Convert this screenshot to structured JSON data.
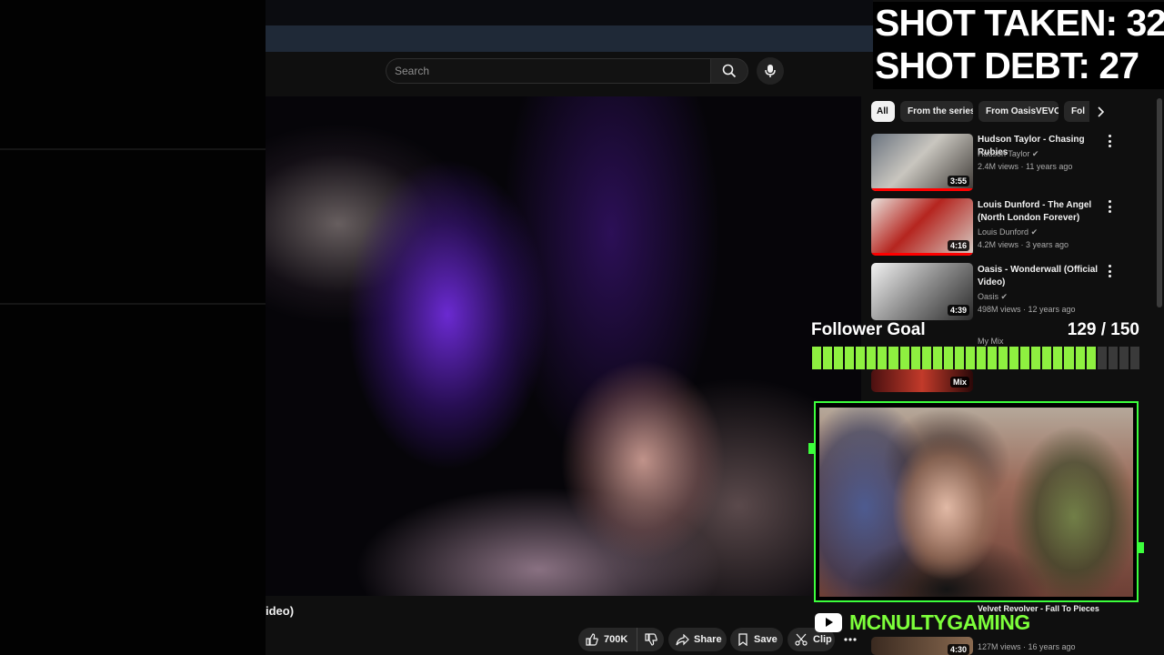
{
  "overlay": {
    "shot_taken": "SHOT TAKEN: 32",
    "shot_debt": "SHOT DEBT: 27",
    "follower_goal_label": "Follower Goal",
    "follower_goal_count": "129 / 150",
    "follower_goal_progress": 0.86,
    "channel_name": "MCNULTYGAMING",
    "accent_color": "#8ef040"
  },
  "header": {
    "search_placeholder": "Search"
  },
  "video": {
    "title_partial": "ideo)",
    "actions": {
      "like_count": "700K",
      "share_label": "Share",
      "save_label": "Save",
      "clip_label": "Clip"
    }
  },
  "sidebar": {
    "chips": [
      "All",
      "From the series",
      "From OasisVEVO",
      "Fol"
    ],
    "recommendations": [
      {
        "title": "Hudson Taylor - Chasing Rubies",
        "channel": "Hudson Taylor",
        "meta": "2.4M views · 11 years ago",
        "duration": "3:55"
      },
      {
        "title": "Louis Dunford - The Angel (North London Forever)",
        "channel": "Louis Dunford",
        "meta": "4.2M views · 3 years ago",
        "duration": "4:16"
      },
      {
        "title": "Oasis - Wonderwall (Official Video)",
        "channel": "Oasis",
        "meta": "498M views · 12 years ago",
        "duration": "4:39"
      },
      {
        "title": "",
        "channel": "My Mix",
        "meta": "",
        "duration": "Mix"
      },
      {
        "title": "Velvet Revolver - Fall To Pieces",
        "channel": "",
        "meta": "127M views · 16 years ago",
        "duration": "4:30"
      }
    ]
  },
  "colors": {
    "background": "#0f0f0f",
    "chip": "#272727",
    "progress_red": "#ff0000",
    "webcam_border": "#3cff3c"
  }
}
